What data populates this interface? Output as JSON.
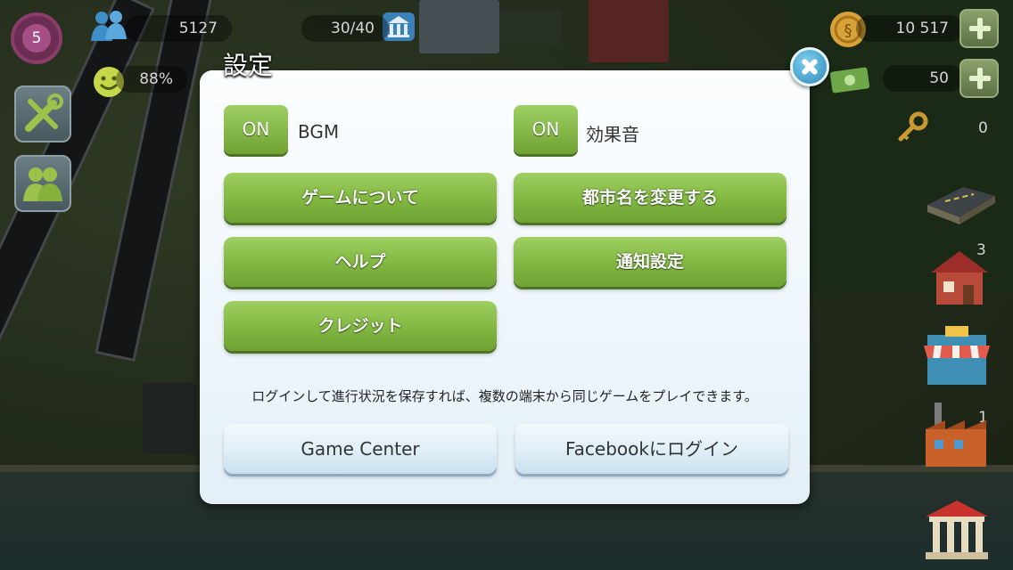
{
  "hud": {
    "level": "5",
    "population": "5127",
    "workers": "30/40",
    "happiness": "88%",
    "simoleons": "10 517",
    "simcash": "50",
    "keys": "0"
  },
  "dialog": {
    "title": "設定",
    "bgm_toggle": "ON",
    "bgm_label": "BGM",
    "sfx_toggle": "ON",
    "sfx_label": "効果音",
    "about_game": "ゲームについて",
    "rename_city": "都市名を変更する",
    "help": "ヘルプ",
    "notifications": "通知設定",
    "credits": "クレジット",
    "login_info": "ログインして進行状況を保存すれば、複数の端末から同じゲームをプレイできます。",
    "game_center": "Game Center",
    "facebook_login": "Facebookにログイン"
  },
  "side_badges": {
    "houses": "3",
    "factory": "1"
  },
  "icons": [
    "settings-gear-icon",
    "population-icon",
    "government-icon",
    "happy-face-icon",
    "build-tools-icon",
    "social-friends-icon",
    "coin-icon",
    "banknote-icon",
    "key-icon",
    "road-icon",
    "house-icon",
    "shop-icon",
    "factory-icon",
    "city-hall-icon",
    "close-icon"
  ]
}
